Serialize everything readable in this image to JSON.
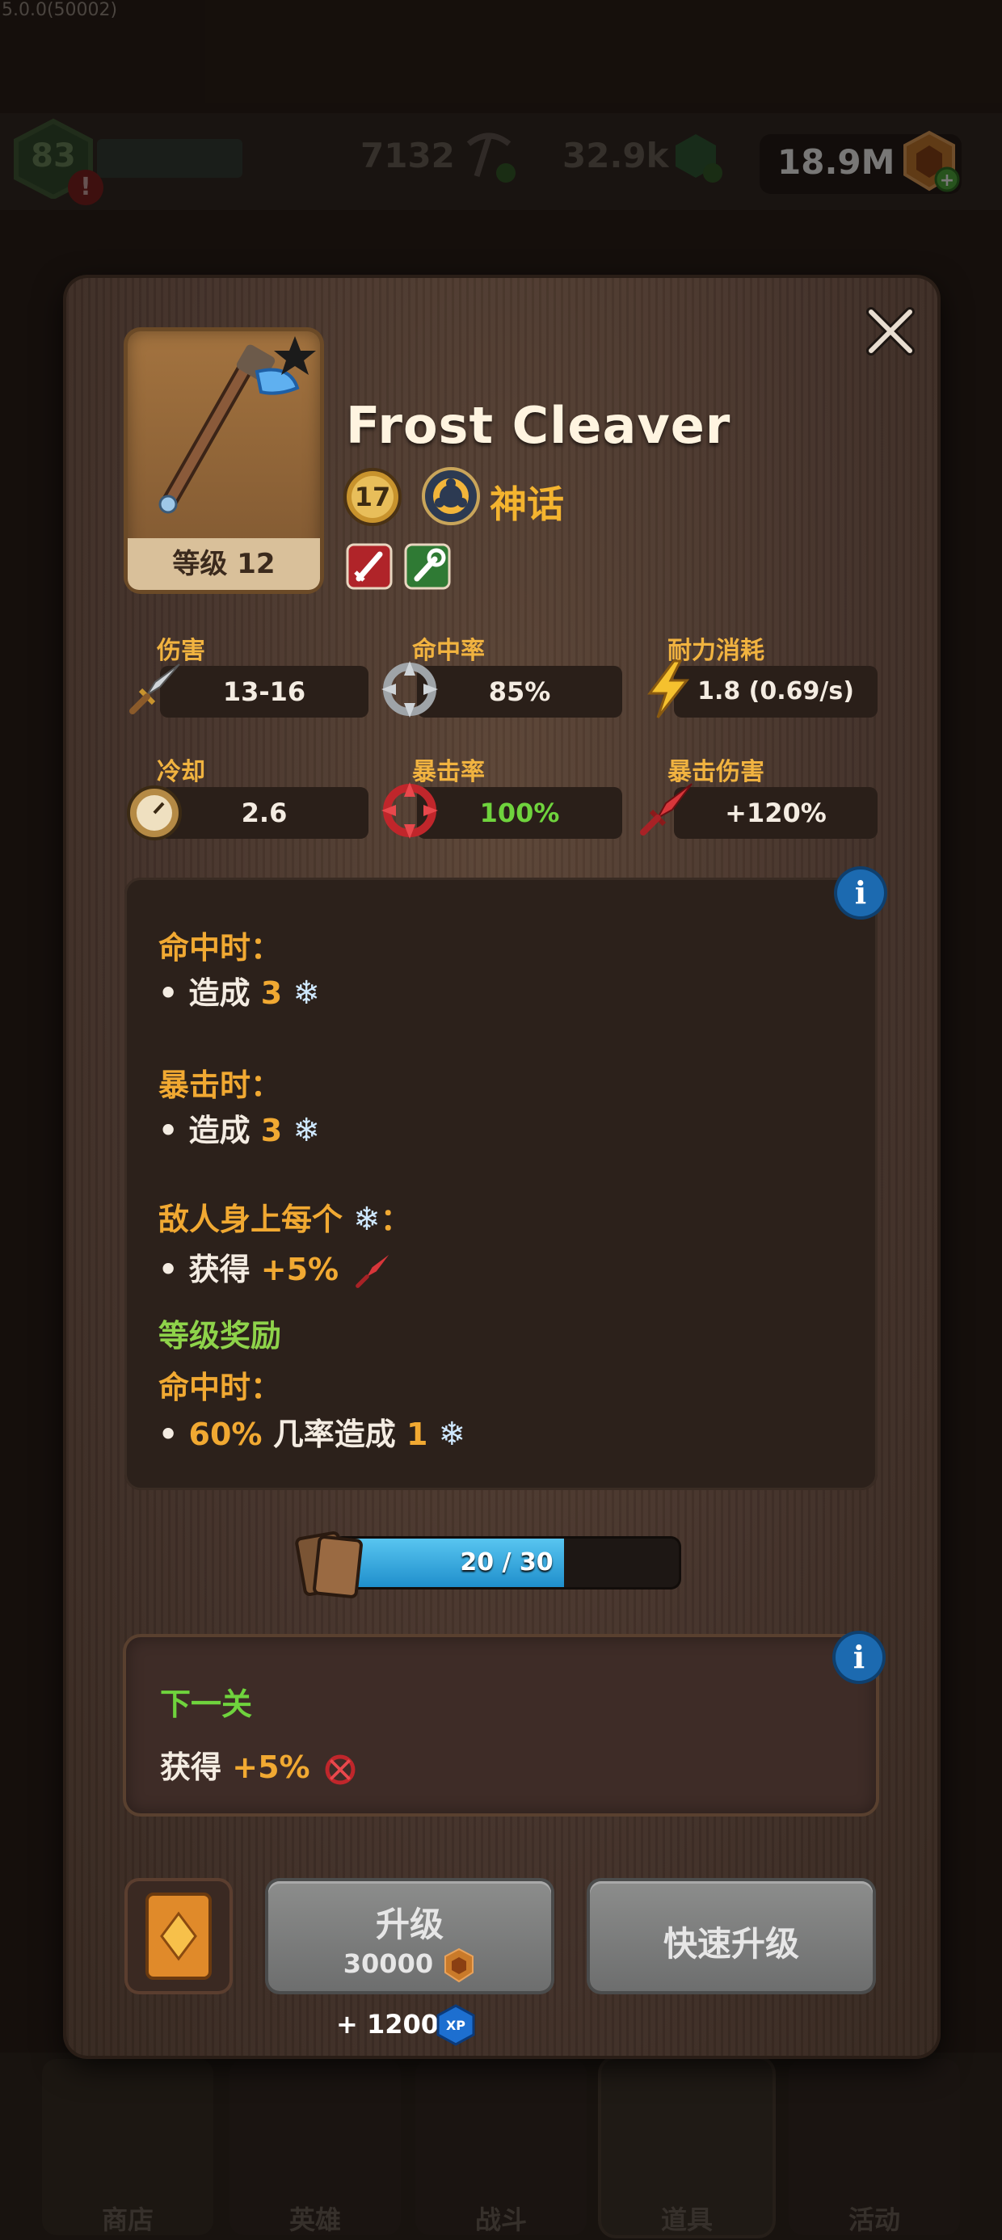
{
  "version": "5.0.0(50002)",
  "topbar": {
    "player_level": "83",
    "alert": "!",
    "resource_1": "7132",
    "resource_2": "32.9k",
    "gold": "18.9M"
  },
  "nav": [
    {
      "label": "商店"
    },
    {
      "label": "英雄"
    },
    {
      "label": "战斗"
    },
    {
      "label": "道具"
    },
    {
      "label": "活动"
    }
  ],
  "item": {
    "name": "Frost Cleaver",
    "card_level": "等级 12",
    "level_badge": "17",
    "rarity": "神话"
  },
  "stats": [
    {
      "label": "伤害",
      "value": "13-16"
    },
    {
      "label": "命中率",
      "value": "85%"
    },
    {
      "label": "耐力消耗",
      "value": "1.8 (0.69/s)"
    },
    {
      "label": "冷却",
      "value": "2.6"
    },
    {
      "label": "暴击率",
      "value": "100%"
    },
    {
      "label": "暴击伤害",
      "value": "+120%"
    }
  ],
  "effects": {
    "info": "i",
    "on_hit_title": "命中时：",
    "on_hit_prefix": "• 造成",
    "on_hit_value": "3",
    "on_crit_title": "暴击时：",
    "on_crit_prefix": "• 造成",
    "on_crit_value": "3",
    "per_stack_title": "敌人身上每个",
    "per_stack_colon": "：",
    "per_stack_prefix": "• 获得",
    "per_stack_value": "+5%",
    "level_bonus_title": "等级奖励",
    "bonus_on_hit_title": "命中时：",
    "bonus_chance": "60%",
    "bonus_mid": "几率造成",
    "bonus_value": "1",
    "snow_glyph": "❄"
  },
  "progress": {
    "text": "20 / 30",
    "current": 20,
    "max": 30
  },
  "next_level": {
    "info": "i",
    "title": "下一关",
    "prefix": "获得",
    "value": "+5%"
  },
  "buttons": {
    "upgrade_label": "升级",
    "upgrade_cost": "30000",
    "quick_upgrade_label": "快速升级",
    "xp_gain": "+ 1200",
    "xp_icon_text": "XP"
  },
  "colors": {
    "accent_orange": "#f1a932",
    "green": "#6fd33d",
    "progress_blue": "#1f8fcc"
  }
}
